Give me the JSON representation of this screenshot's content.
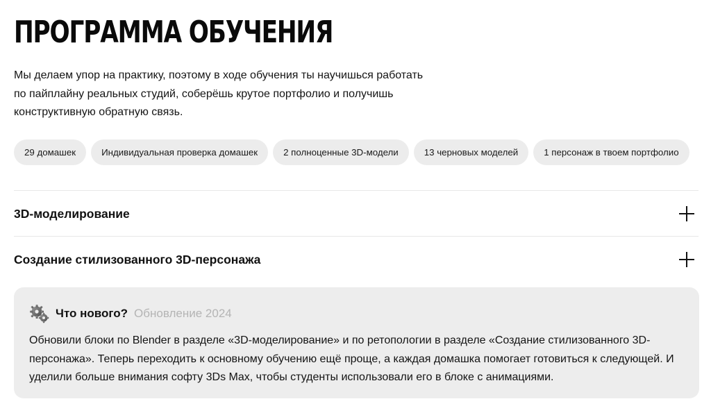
{
  "page": {
    "title": "ПРОГРАММА ОБУЧЕНИЯ",
    "intro": "Мы делаем упор на практику, поэтому в ходе обучения ты научишься работать по пайплайну реальных студий, соберёшь крутое портфолио и получишь конструктивную обратную связь."
  },
  "tags": [
    "29 домашек",
    "Индивидуальная проверка домашек",
    "2 полноценные 3D-модели",
    "13 черновых моделей",
    "1 персонаж в твоем портфолио"
  ],
  "accordion": [
    {
      "title": "3D-моделирование",
      "icon": "plus-icon"
    },
    {
      "title": "Создание стилизованного 3D-персонажа",
      "icon": "plus-icon"
    }
  ],
  "news": {
    "icon": "gear-icon",
    "title": "Что нового?",
    "subtitle": "Обновление 2024",
    "text": "Обновили блоки по Blender в разделе «3D-моделирование» и по ретопологии в разделе «Создание стилизованного 3D-персонажа». Теперь переходить к основному обучению ещё проще, а каждая домашка помогает готовиться к следующей. И уделили больше внимания софту 3Ds Max, чтобы студенты использовали его в блоке с анимациями."
  },
  "colors": {
    "text": "#111111",
    "tag_bg": "#ececec",
    "news_bg": "#ededed",
    "muted": "#b4b4b4",
    "divider": "#e8e8e8"
  }
}
